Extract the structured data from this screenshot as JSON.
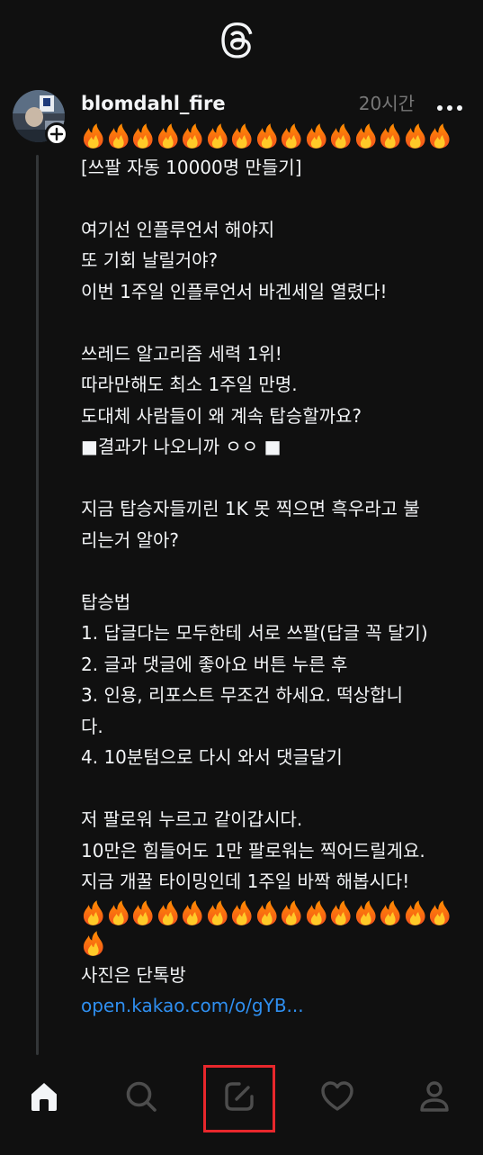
{
  "header": {
    "logo_icon": "threads-logo-icon"
  },
  "post": {
    "username": "blomdahl_fire",
    "timestamp": "20시간",
    "more_icon": "more-horizontal-icon",
    "avatar_icon": "avatar",
    "follow_icon": "plus-icon",
    "fire_emoji": "🔥",
    "lines": [
      {
        "type": "fires",
        "count": 15
      },
      {
        "type": "text",
        "text": "[쓰팔 자동 10000명 만들기]"
      },
      {
        "type": "blank"
      },
      {
        "type": "text",
        "text": "여기선 인플루언서 해야지"
      },
      {
        "type": "text",
        "text": "또 기회 날릴거야?"
      },
      {
        "type": "text",
        "text": "이번 1주일 인플루언서 바겐세일 열렸다!"
      },
      {
        "type": "blank"
      },
      {
        "type": "text",
        "text": "쓰레드 알고리즘 세력 1위!"
      },
      {
        "type": "text",
        "text": "따라만해도 최소 1주일 만명."
      },
      {
        "type": "text",
        "text": "도대체 사람들이 왜 계속 탑승할까요?"
      },
      {
        "type": "text",
        "text": "■결과가 나오니까 ㅇㅇ ■"
      },
      {
        "type": "blank"
      },
      {
        "type": "text",
        "text": "지금 탑승자들끼린 1K 못 찍으면 흑우라고 불"
      },
      {
        "type": "text",
        "text": "리는거 알아?"
      },
      {
        "type": "blank"
      },
      {
        "type": "text",
        "text": "탑승법"
      },
      {
        "type": "text",
        "text": "1. 답글다는 모두한테 서로 쓰팔(답글 꼭 달기)"
      },
      {
        "type": "text",
        "text": "2. 글과 댓글에 좋아요 버튼 누른 후"
      },
      {
        "type": "text",
        "text": "3. 인용, 리포스트 무조건 하세요.  떡상합니"
      },
      {
        "type": "text",
        "text": "다."
      },
      {
        "type": "text",
        "text": "4. 10분텀으로 다시 와서 댓글달기"
      },
      {
        "type": "blank"
      },
      {
        "type": "text",
        "text": "저 팔로워 누르고 같이갑시다."
      },
      {
        "type": "text",
        "text": "10만은 힘들어도 1만 팔로워는 찍어드릴게요."
      },
      {
        "type": "text",
        "text": "지금 개꿀 타이밍인데 1주일 바짝 해봅시다!"
      },
      {
        "type": "fires",
        "count": 15
      },
      {
        "type": "fires",
        "count": 1
      },
      {
        "type": "text",
        "text": "사진은 단톡방"
      },
      {
        "type": "link",
        "text": "open.kakao.com/o/gYB..."
      }
    ]
  },
  "tabbar": {
    "tabs": [
      {
        "name": "home",
        "icon": "home-icon",
        "active": true
      },
      {
        "name": "search",
        "icon": "search-icon",
        "active": false
      },
      {
        "name": "create",
        "icon": "compose-icon",
        "active": false,
        "highlighted": true
      },
      {
        "name": "activity",
        "icon": "heart-icon",
        "active": false
      },
      {
        "name": "profile",
        "icon": "profile-icon",
        "active": false
      }
    ]
  },
  "colors": {
    "background": "#101010",
    "text": "#f3f5f7",
    "muted": "#777777",
    "link": "#2f8ff0",
    "highlight": "#e8272c"
  }
}
